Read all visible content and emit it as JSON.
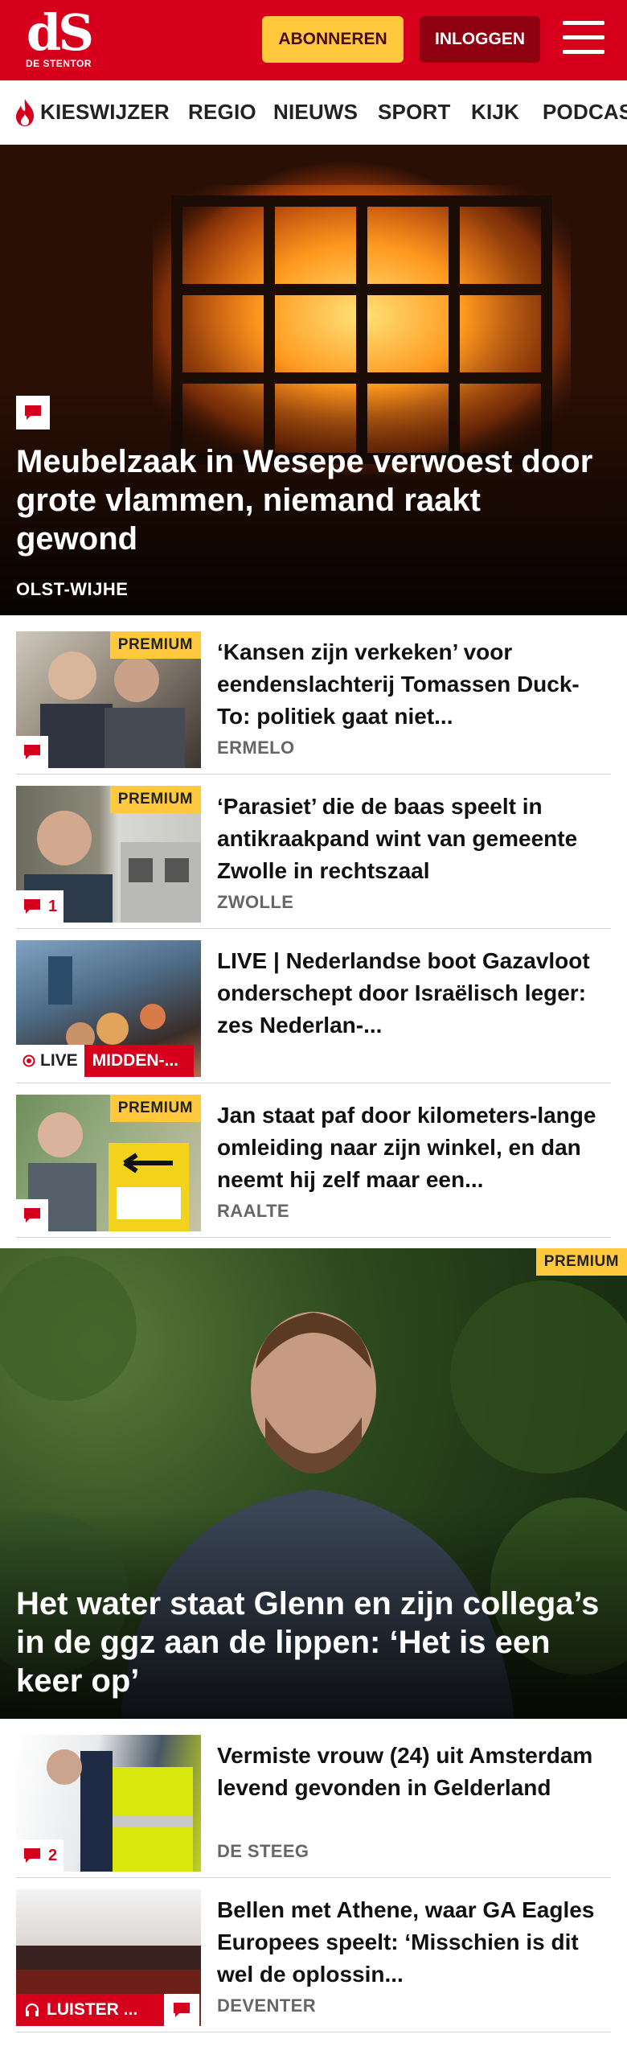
{
  "header": {
    "logo_mark": "dS",
    "logo_text": "DE STENTOR",
    "subscribe_label": "ABONNEREN",
    "login_label": "INLOGGEN",
    "brand_color": "#d6001c",
    "accent_color": "#ffc83d"
  },
  "nav": {
    "items": [
      {
        "label": "KIESWIJZER",
        "icon": "flame-icon"
      },
      {
        "label": "REGIO"
      },
      {
        "label": "NIEUWS"
      },
      {
        "label": "SPORT"
      },
      {
        "label": "KIJK"
      },
      {
        "label": "PODCAS"
      }
    ]
  },
  "hero": {
    "title": "Meubelzaak in Wesepe verwoest door grote vlammen, niemand raakt gewond",
    "kicker": "OLST-WIJHE",
    "icon": "comment-icon"
  },
  "articles": [
    {
      "title": "‘Kansen zijn verkeken’ voor eendenslachterij Tomassen Duck-To: politiek gaat niet...",
      "kicker": "ERMELO",
      "badge": "PREMIUM",
      "comments": ""
    },
    {
      "title": "‘Parasiet’ die de baas speelt in antikraakpand wint van gemeente Zwolle in rechtszaal",
      "kicker": "ZWOLLE",
      "badge": "PREMIUM",
      "comments": "1"
    },
    {
      "title": "LIVE | Nederlandse boot Gazavloot onderschept door Israëlisch leger: zes Nederlan-...",
      "kicker": "",
      "live_label": "LIVE",
      "region": "MIDDEN-..."
    },
    {
      "title": "Jan staat paf door kilometers-lange omleiding naar zijn winkel, en dan neemt hij zelf maar een...",
      "kicker": "RAALTE",
      "badge": "PREMIUM",
      "comments": ""
    }
  ],
  "feature": {
    "badge": "PREMIUM",
    "title": "Het water staat Glenn en zijn collega’s in de ggz aan de lippen: ‘Het is een keer op’"
  },
  "articles2": [
    {
      "title": "Vermiste vrouw (24) uit Amsterdam levend gevonden in Gelderland",
      "kicker": "DE STEEG",
      "comments": "2"
    },
    {
      "title": "Bellen met Athene, waar GA Eagles Europees speelt: ‘Misschien is dit wel de oplossin...",
      "kicker": "DEVENTER",
      "listen_label": "LUISTER ..."
    }
  ]
}
